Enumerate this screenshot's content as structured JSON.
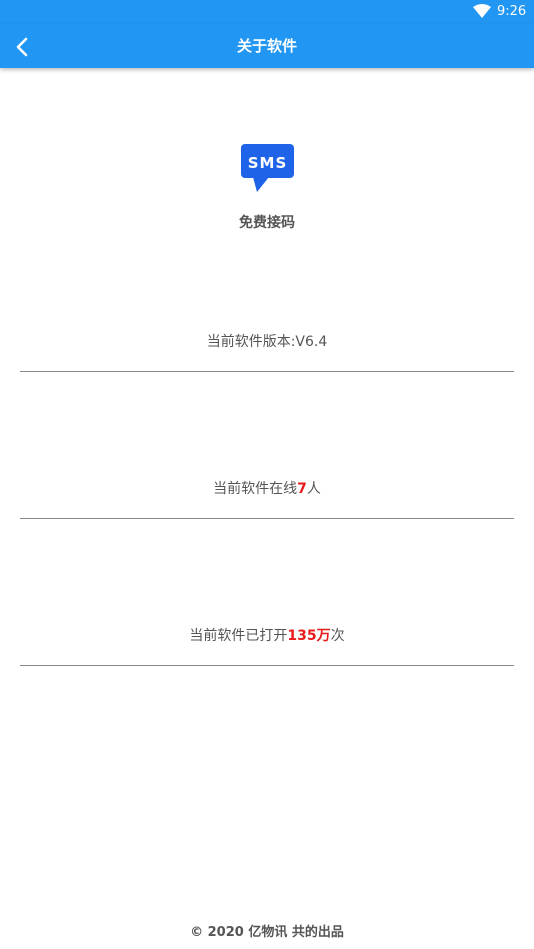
{
  "status_bar": {
    "time": "9:26",
    "wifi_icon": "wifi-icon",
    "background_color": "#2196f3"
  },
  "app_bar": {
    "title": "关于软件",
    "back_icon": "chevron-left-icon",
    "background_color": "#2196f3"
  },
  "logo": {
    "icon": "sms-chat-bubble-icon",
    "text": "SMS",
    "color": "#1e63e8"
  },
  "app_name": "免费接码",
  "info": {
    "version": {
      "label": "当前软件版本:V6.4"
    },
    "online": {
      "prefix": "当前软件在线",
      "value": "7",
      "suffix": "人"
    },
    "opened": {
      "prefix": "当前软件已打开",
      "value": "135万",
      "suffix": "次"
    },
    "highlight_color": "#e81c1c"
  },
  "footer": {
    "text": "© 2020 亿物讯 共的出品"
  }
}
